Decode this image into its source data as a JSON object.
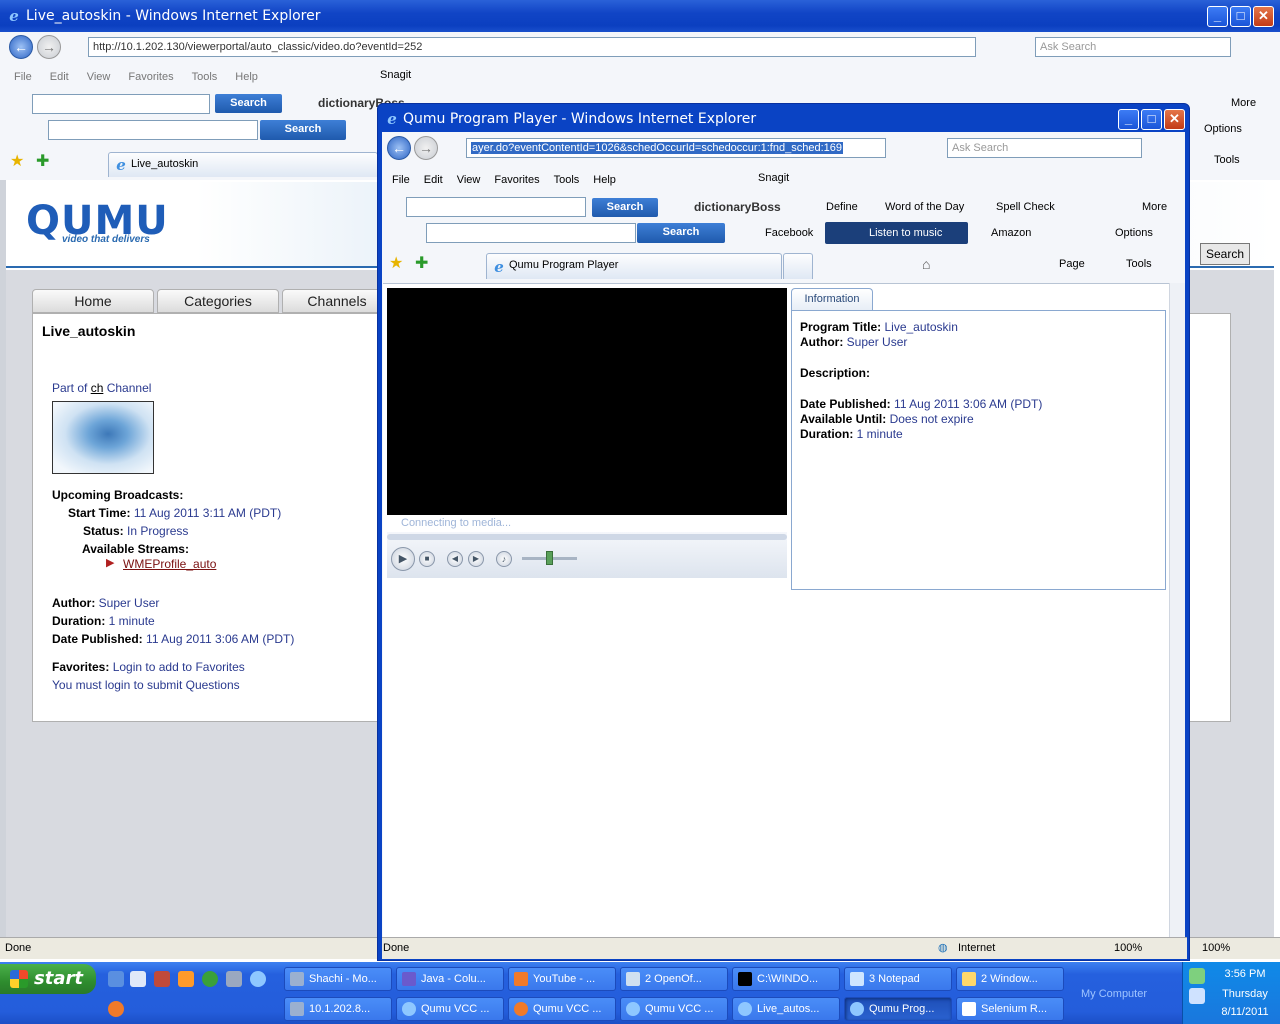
{
  "bg": {
    "title": "Live_autoskin - Windows Internet Explorer",
    "address": "http://10.1.202.130/viewerportal/auto_classic/video.do?eventId=252",
    "search_placeholder": "Ask Search",
    "menu": [
      "File",
      "Edit",
      "View",
      "Favorites",
      "Tools",
      "Help"
    ],
    "snagit": "Snagit",
    "search_btn": "Search",
    "dictionary": "dictionaryBoss",
    "more": "More",
    "options": "Options",
    "tools": "Tools",
    "tab_label": "Live_autoskin",
    "page_search_btn": "Search",
    "status": "Done",
    "zoom": "100%"
  },
  "portal": {
    "logo": "QUMU",
    "tagline": "video that delivers",
    "nav": [
      "Home",
      "Categories",
      "Channels"
    ],
    "program_title": "Live_autoskin",
    "part_of_prefix": "Part of ",
    "channel_link": "ch",
    "channel_suffix": " Channel",
    "upcoming_label": "Upcoming Broadcasts:",
    "start_time_label": "Start Time:",
    "start_time": "11 Aug 2011 3:11 AM (PDT)",
    "status_label": "Status:",
    "status": "In Progress",
    "streams_label": "Available Streams:",
    "stream_link": "WMEProfile_auto",
    "author_label": "Author:",
    "author": "Super User",
    "duration_label": "Duration:",
    "duration": "1 minute",
    "published_label": "Date Published:",
    "published": "11 Aug 2011 3:06 AM (PDT)",
    "favorites_label": "Favorites:",
    "favorites_link": "Login to add to Favorites",
    "questions_text": "You must login to submit Questions"
  },
  "popup": {
    "title": "Qumu Program Player - Windows Internet Explorer",
    "address": "ayer.do?eventContentId=1026&schedOccurId=schedoccur:1:fnd_sched:169",
    "search_placeholder": "Ask Search",
    "menu": [
      "File",
      "Edit",
      "View",
      "Favorites",
      "Tools",
      "Help"
    ],
    "snagit": "Snagit",
    "search_btn": "Search",
    "dictionary": "dictionaryBoss",
    "define": "Define",
    "word_of_day": "Word of the Day",
    "spell_check": "Spell Check",
    "more": "More",
    "facebook": "Facebook",
    "listen": "Listen to music",
    "amazon": "Amazon",
    "options": "Options",
    "tab_label": "Qumu Program Player",
    "page_menu": "Page",
    "tools_menu": "Tools",
    "player_status": "Connecting to media...",
    "info_tab": "Information",
    "prog_title_label": "Program Title:",
    "prog_title": "Live_autoskin",
    "author_label": "Author:",
    "author": "Super User",
    "description_label": "Description:",
    "published_label": "Date Published:",
    "published": "11 Aug 2011 3:06 AM (PDT)",
    "available_label": "Available Until:",
    "available": "Does not expire",
    "duration_label": "Duration:",
    "duration": "1 minute",
    "status": "Done",
    "zone": "Internet",
    "zoom": "100%"
  },
  "taskbar": {
    "start": "start",
    "row1": [
      "Shachi - Mo...",
      "Java - Colu...",
      "YouTube - ...",
      "2 OpenOf...",
      "C:\\WINDO...",
      "3 Notepad",
      "2 Window..."
    ],
    "row2": [
      "10.1.202.8...",
      "Qumu VCC ...",
      "Qumu VCC ...",
      "Qumu VCC ...",
      "Live_autos...",
      "Qumu Prog...",
      "Selenium R..."
    ],
    "my_computer": "My Computer",
    "time": "3:56 PM",
    "day": "Thursday",
    "date": "8/11/2011"
  }
}
